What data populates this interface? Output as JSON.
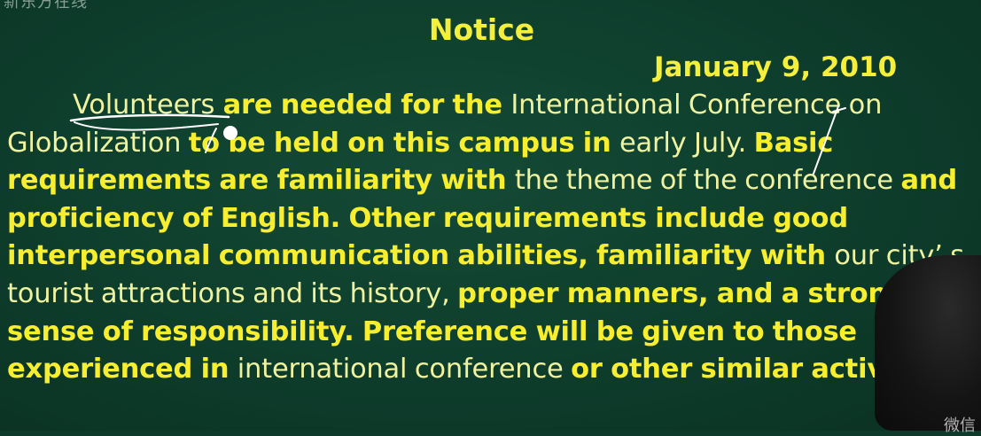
{
  "notice": {
    "corner_text": "新东方在线",
    "title": "Notice",
    "date": "January 9, 2010",
    "paragraph": [
      {
        "t": "Volunteers",
        "w": "n"
      },
      {
        "t": " are needed for the ",
        "w": "b"
      },
      {
        "t": "International Conference on Globalization ",
        "w": "n"
      },
      {
        "t": "to be held on this campus in ",
        "w": "b"
      },
      {
        "t": "early July. ",
        "w": "n"
      },
      {
        "t": "Basic requirements are familiarity with ",
        "w": "b"
      },
      {
        "t": "the theme of the conference ",
        "w": "n"
      },
      {
        "t": "and proficiency of English. Other requirements include good interpersonal communication abilities, familiarity with ",
        "w": "b"
      },
      {
        "t": "our city’ s tourist attractions and its history, ",
        "w": "n"
      },
      {
        "t": "proper manners, and a strong sense of responsibility. Preference will be given to those experienced in ",
        "w": "b"
      },
      {
        "t": "international conference ",
        "w": "n"
      },
      {
        "t": "or other similar activities.",
        "w": "b"
      }
    ]
  },
  "overlay": {
    "watermark": "微信"
  },
  "colors": {
    "board": "#0e3d2c",
    "text_yellow": "#f4ee3c",
    "chalk_white": "#ffffff"
  }
}
